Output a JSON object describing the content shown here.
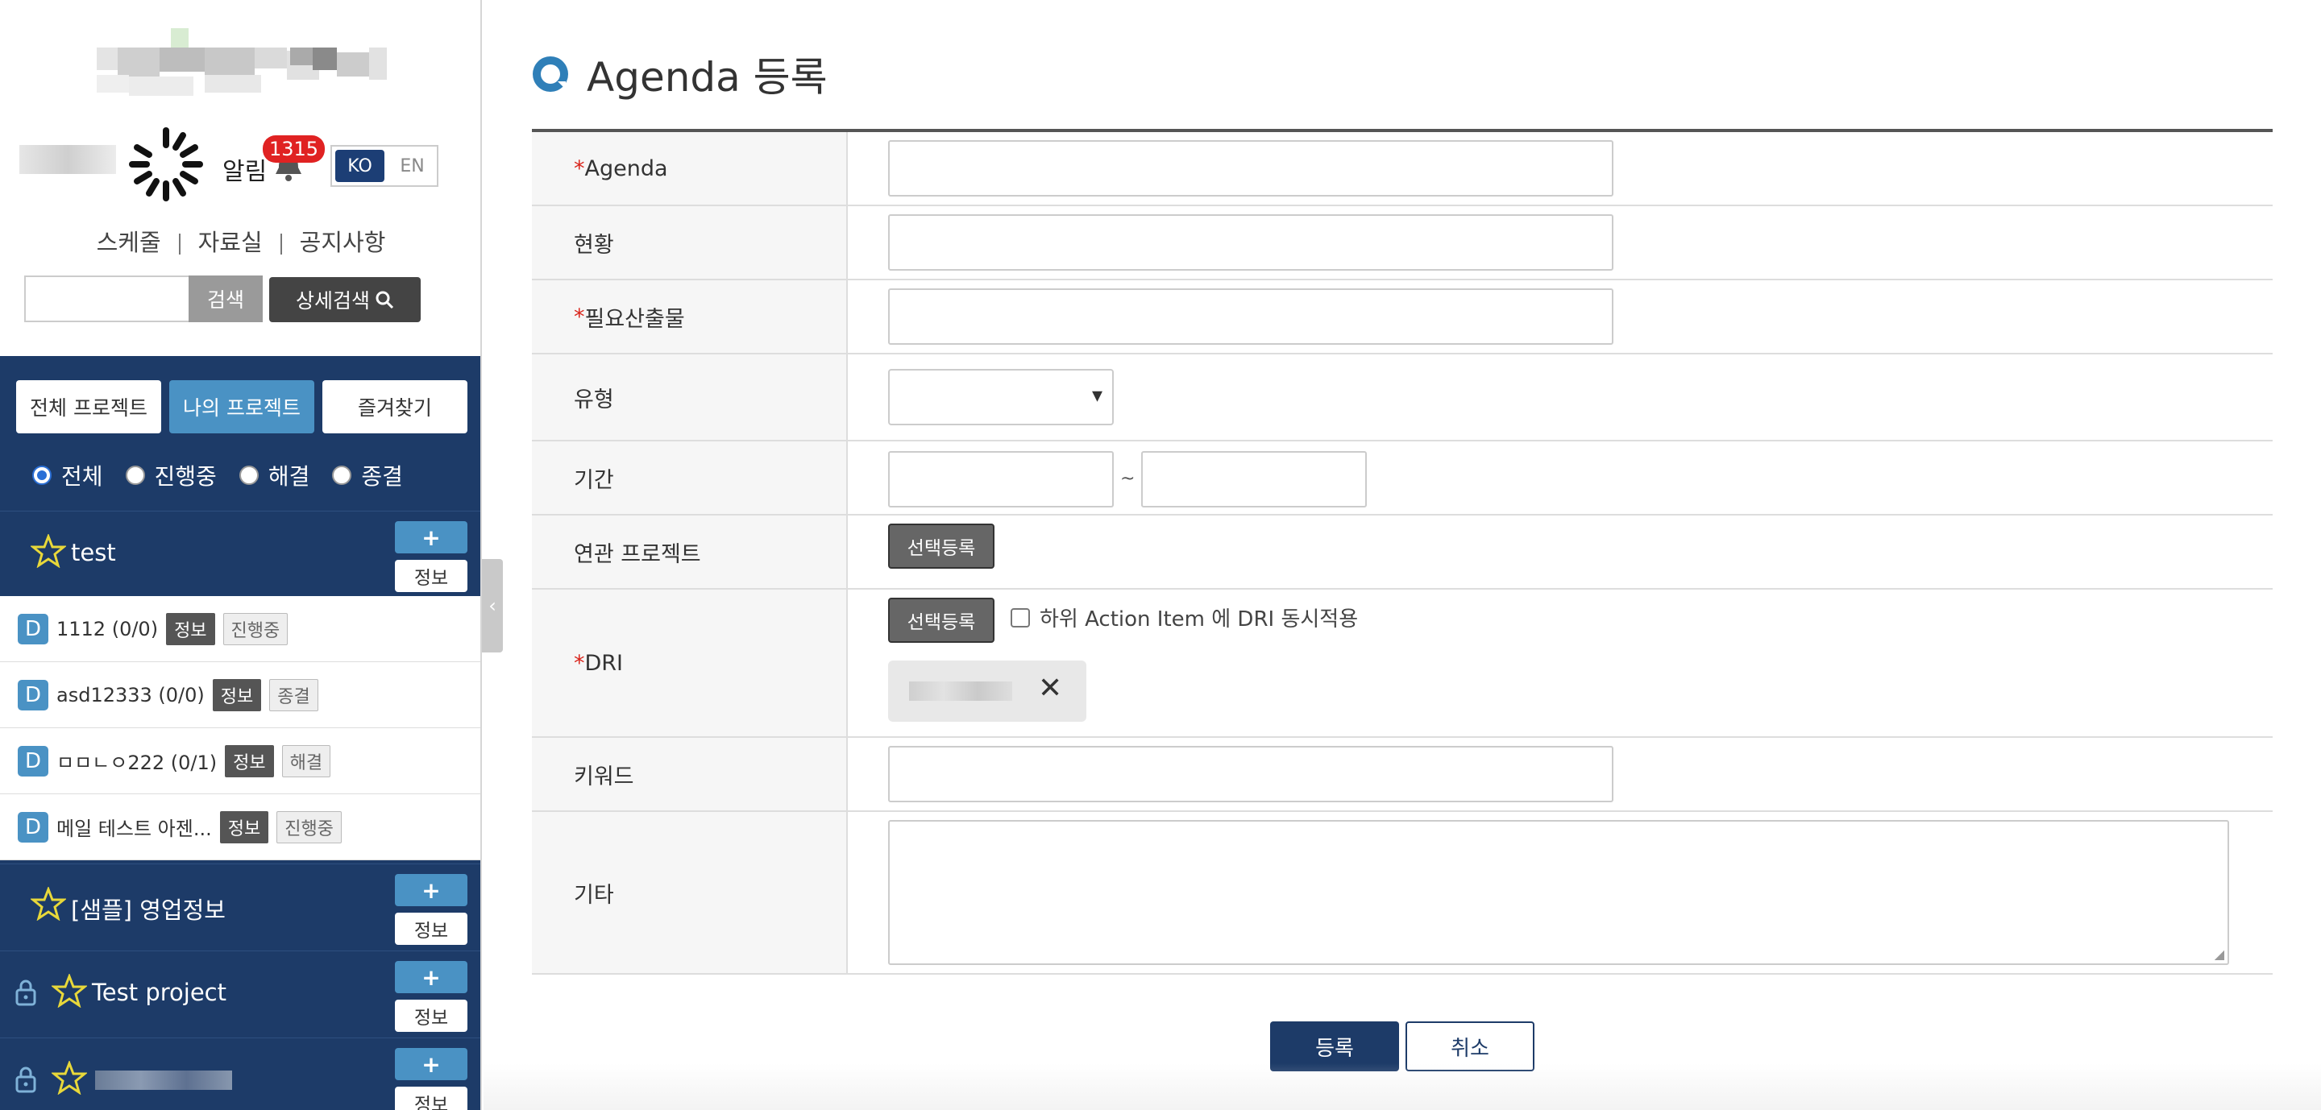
{
  "sidebar": {
    "alarm": {
      "label": "알림",
      "count": "1315"
    },
    "lang": {
      "ko": "KO",
      "en": "EN"
    },
    "links": [
      "스케줄",
      "자료실",
      "공지사항"
    ],
    "search": {
      "placeholder": "",
      "button": "검색",
      "advanced": "상세검색"
    },
    "tabs": [
      {
        "label": "전체 프로젝트",
        "active": false
      },
      {
        "label": "나의 프로젝트",
        "active": true
      },
      {
        "label": "즐겨찾기",
        "active": false
      }
    ],
    "filters": [
      {
        "label": "전체",
        "checked": true
      },
      {
        "label": "진행중",
        "checked": false
      },
      {
        "label": "해결",
        "checked": false
      },
      {
        "label": "종결",
        "checked": false
      }
    ],
    "projects": [
      {
        "title": "test",
        "locked": false,
        "plus": "+",
        "info": "정보"
      },
      {
        "title": "[샘플] 영업정보",
        "locked": false,
        "plus": "+",
        "info": "정보"
      },
      {
        "title": "Test project",
        "locked": true,
        "plus": "+",
        "info": "정보"
      },
      {
        "title": "",
        "locked": true,
        "plus": "+",
        "info": "정보"
      }
    ],
    "sub_items": [
      {
        "badge": "D",
        "name": "1112 (0/0)",
        "info": "정보",
        "status": "진행중"
      },
      {
        "badge": "D",
        "name": "asd12333 (0/0)",
        "info": "정보",
        "status": "종결"
      },
      {
        "badge": "D",
        "name": "ㅁㅁㄴㅇ222 (0/1)",
        "info": "정보",
        "status": "해결"
      },
      {
        "badge": "D",
        "name": "메일 테스트 아젠...",
        "info": "정보",
        "status": "진행중"
      }
    ],
    "collapse_glyph": "‹"
  },
  "main": {
    "title": "Agenda 등록",
    "fields": {
      "agenda": {
        "required": "*",
        "label": "Agenda",
        "value": ""
      },
      "status": {
        "label": "현황",
        "value": ""
      },
      "deliverable": {
        "required": "*",
        "label": "필요산출물",
        "value": ""
      },
      "type": {
        "label": "유형",
        "value": ""
      },
      "period": {
        "label": "기간",
        "start": "",
        "end": "",
        "separator": "~"
      },
      "related": {
        "label": "연관 프로젝트",
        "button": "선택등록"
      },
      "dri": {
        "required": "* ",
        "label": "DRI",
        "button": "선택등록",
        "checkbox_label": "하위 Action Item 에 DRI 동시적용",
        "chip_remove": "✕"
      },
      "keyword": {
        "label": "키워드",
        "value": ""
      },
      "etc": {
        "label": "기타",
        "value": ""
      }
    },
    "actions": {
      "save": "등록",
      "cancel": "취소"
    }
  },
  "colors": {
    "navy": "#1d3b68",
    "accent": "#4a92c4",
    "required": "#d9251c",
    "badge": "#e02222"
  }
}
